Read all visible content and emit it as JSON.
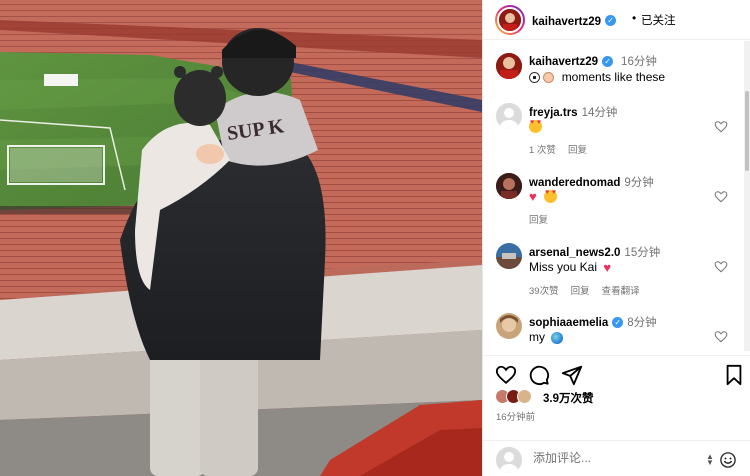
{
  "post": {
    "author": "kaihavertz29",
    "follow_status": "已关注",
    "caption_time": "16分钟",
    "caption_text": "moments like these",
    "likes": "3.9万次赞",
    "posted_ago": "16分钟前"
  },
  "comments": [
    {
      "username": "freyja.trs",
      "time": "14分钟",
      "text_emoji": "heart-eyes",
      "text": "",
      "likes": "1 次赞",
      "reply": "回复",
      "translate": ""
    },
    {
      "username": "wanderednomad",
      "time": "9分钟",
      "text_emoji": "heart heart-eyes",
      "text": "",
      "likes": "",
      "reply": "回复",
      "translate": ""
    },
    {
      "username": "arsenal_news2.0",
      "time": "15分钟",
      "text": "Miss you Kai",
      "likes": "39次赞",
      "reply": "回复",
      "translate": "查看翻译"
    },
    {
      "username": "sophiaaemelia",
      "time": "8分钟",
      "text": "my",
      "likes": "",
      "reply": "",
      "translate": ""
    }
  ],
  "add_comment": {
    "placeholder": "添加评论..."
  },
  "icons": {
    "header_verified": "verified-badge-icon",
    "like": "heart-icon",
    "comment": "comment-bubble-icon",
    "share": "paper-plane-icon",
    "save": "bookmark-icon",
    "emoji": "smiley-icon"
  },
  "colors": {
    "verified": "#3897f0",
    "secondary_text": "#737373",
    "heart_emoji": "#ed2f5c"
  }
}
